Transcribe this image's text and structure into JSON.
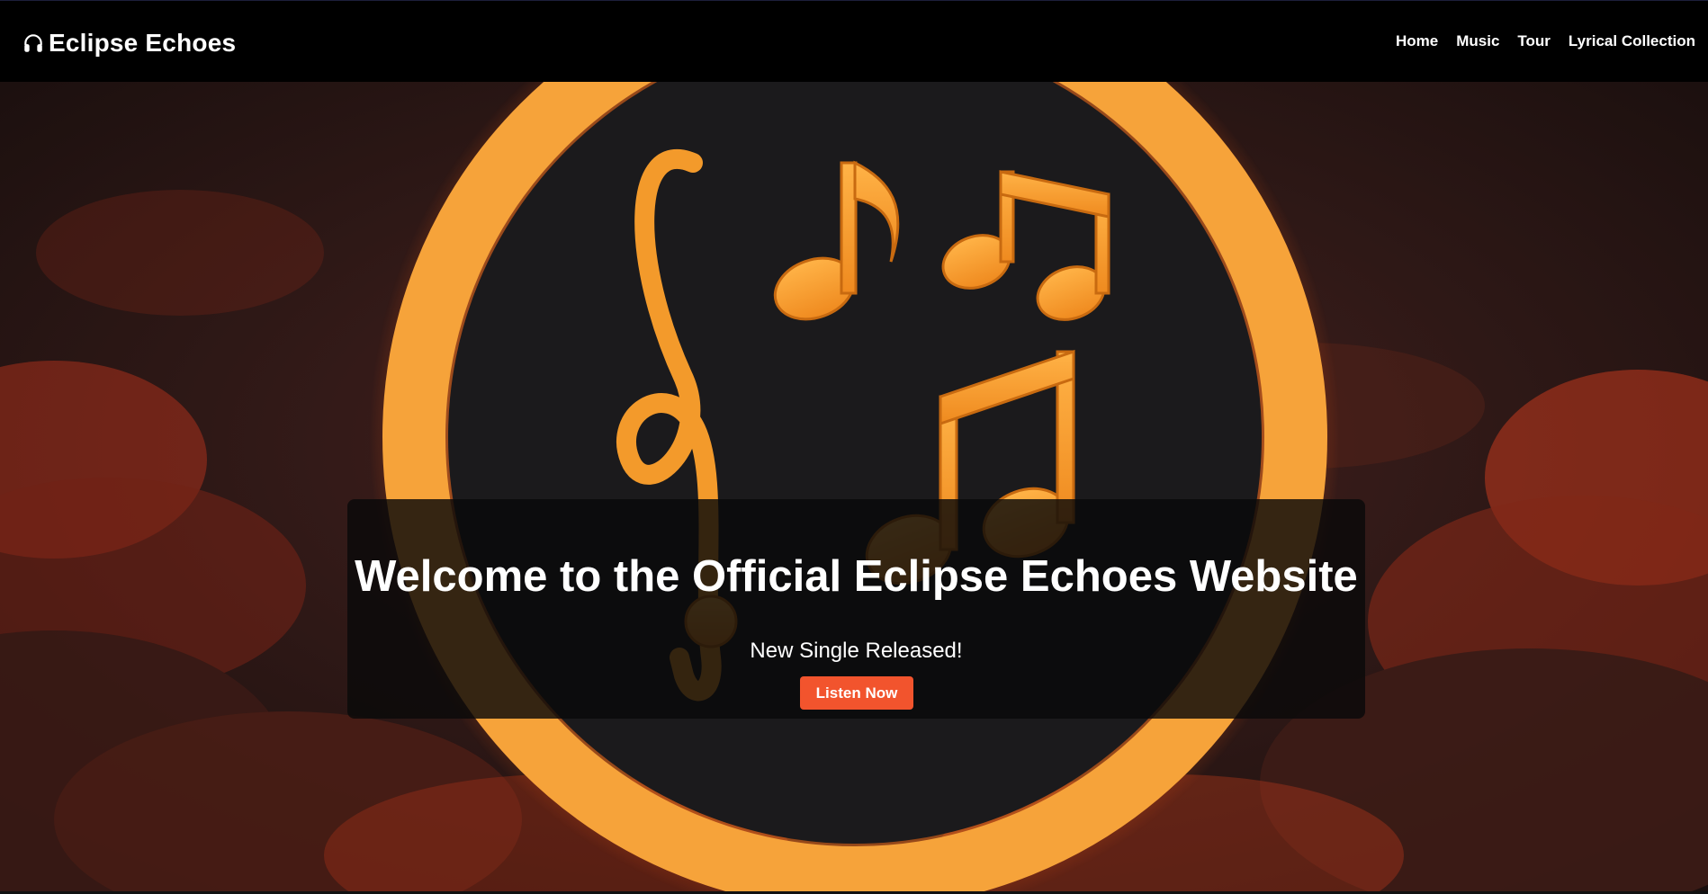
{
  "header": {
    "brand": "Eclipse Echoes",
    "brand_icon": "headphones-icon",
    "nav": [
      "Home",
      "Music",
      "Tour",
      "Lyrical Collection"
    ]
  },
  "hero": {
    "background": "eclipse-with-music-notes-image",
    "title": "Welcome to the Official Eclipse Echoes Website",
    "subtitle": "New Single Released!",
    "cta_label": "Listen Now"
  },
  "colors": {
    "navbar_bg": "#000000",
    "accent": "#f2542d",
    "ring": "#f7a53a",
    "notes": "#f39a2b",
    "overlay": "#0a0a0a"
  }
}
